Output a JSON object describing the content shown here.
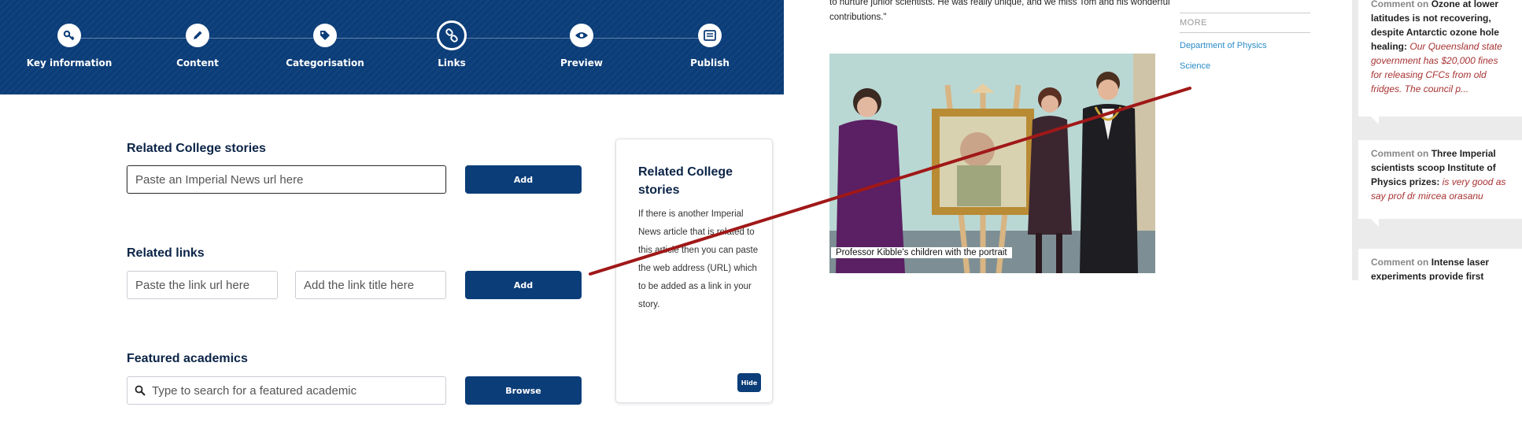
{
  "steps": [
    {
      "label": "Key information",
      "icon": "key-icon"
    },
    {
      "label": "Content",
      "icon": "pencil-icon"
    },
    {
      "label": "Categorisation",
      "icon": "tag-icon"
    },
    {
      "label": "Links",
      "icon": "link-icon",
      "active": true
    },
    {
      "label": "Preview",
      "icon": "eye-icon"
    },
    {
      "label": "Publish",
      "icon": "publish-icon"
    }
  ],
  "related_stories": {
    "title": "Related College stories",
    "placeholder": "Paste an Imperial News url here",
    "add_label": "Add"
  },
  "related_links": {
    "title": "Related links",
    "url_placeholder": "Paste the link url here",
    "title_placeholder": "Add the link title here",
    "add_label": "Add"
  },
  "featured_academics": {
    "title": "Featured academics",
    "placeholder": "Type to search for a featured academic",
    "browse_label": "Browse"
  },
  "help_card": {
    "title": "Related College stories",
    "text": "If there is another Imperial News article that is related to this article then you can paste the web address (URL) which to be added as a link in your story.",
    "hide_label": "Hide"
  },
  "article": {
    "quote": "to nurture junior scientists. He was really unique, and we miss Tom and his wonderful contributions.\"",
    "caption": "Professor Kibble's children with the portrait"
  },
  "more": {
    "label": "MORE",
    "links": [
      "Department of Physics",
      "Science"
    ]
  },
  "comments": [
    {
      "on": "Comment on",
      "title": "Ozone at lower latitudes is not recovering, despite Antarctic ozone hole healing:",
      "text": "Our Queensland state government has $20,000 fines for releasing CFCs from old fridges. The council p..."
    },
    {
      "on": "Comment on",
      "title": "Three Imperial scientists scoop Institute of Physics prizes:",
      "text": "is very good as say prof dr mircea orasanu"
    },
    {
      "on": "Comment on",
      "title": "Intense laser experiments provide first",
      "text": ""
    }
  ],
  "colors": {
    "brand_navy": "#0b3d78",
    "link_blue": "#2a8bc7",
    "comment_red": "#a83232",
    "annotation_red": "#a01818"
  }
}
